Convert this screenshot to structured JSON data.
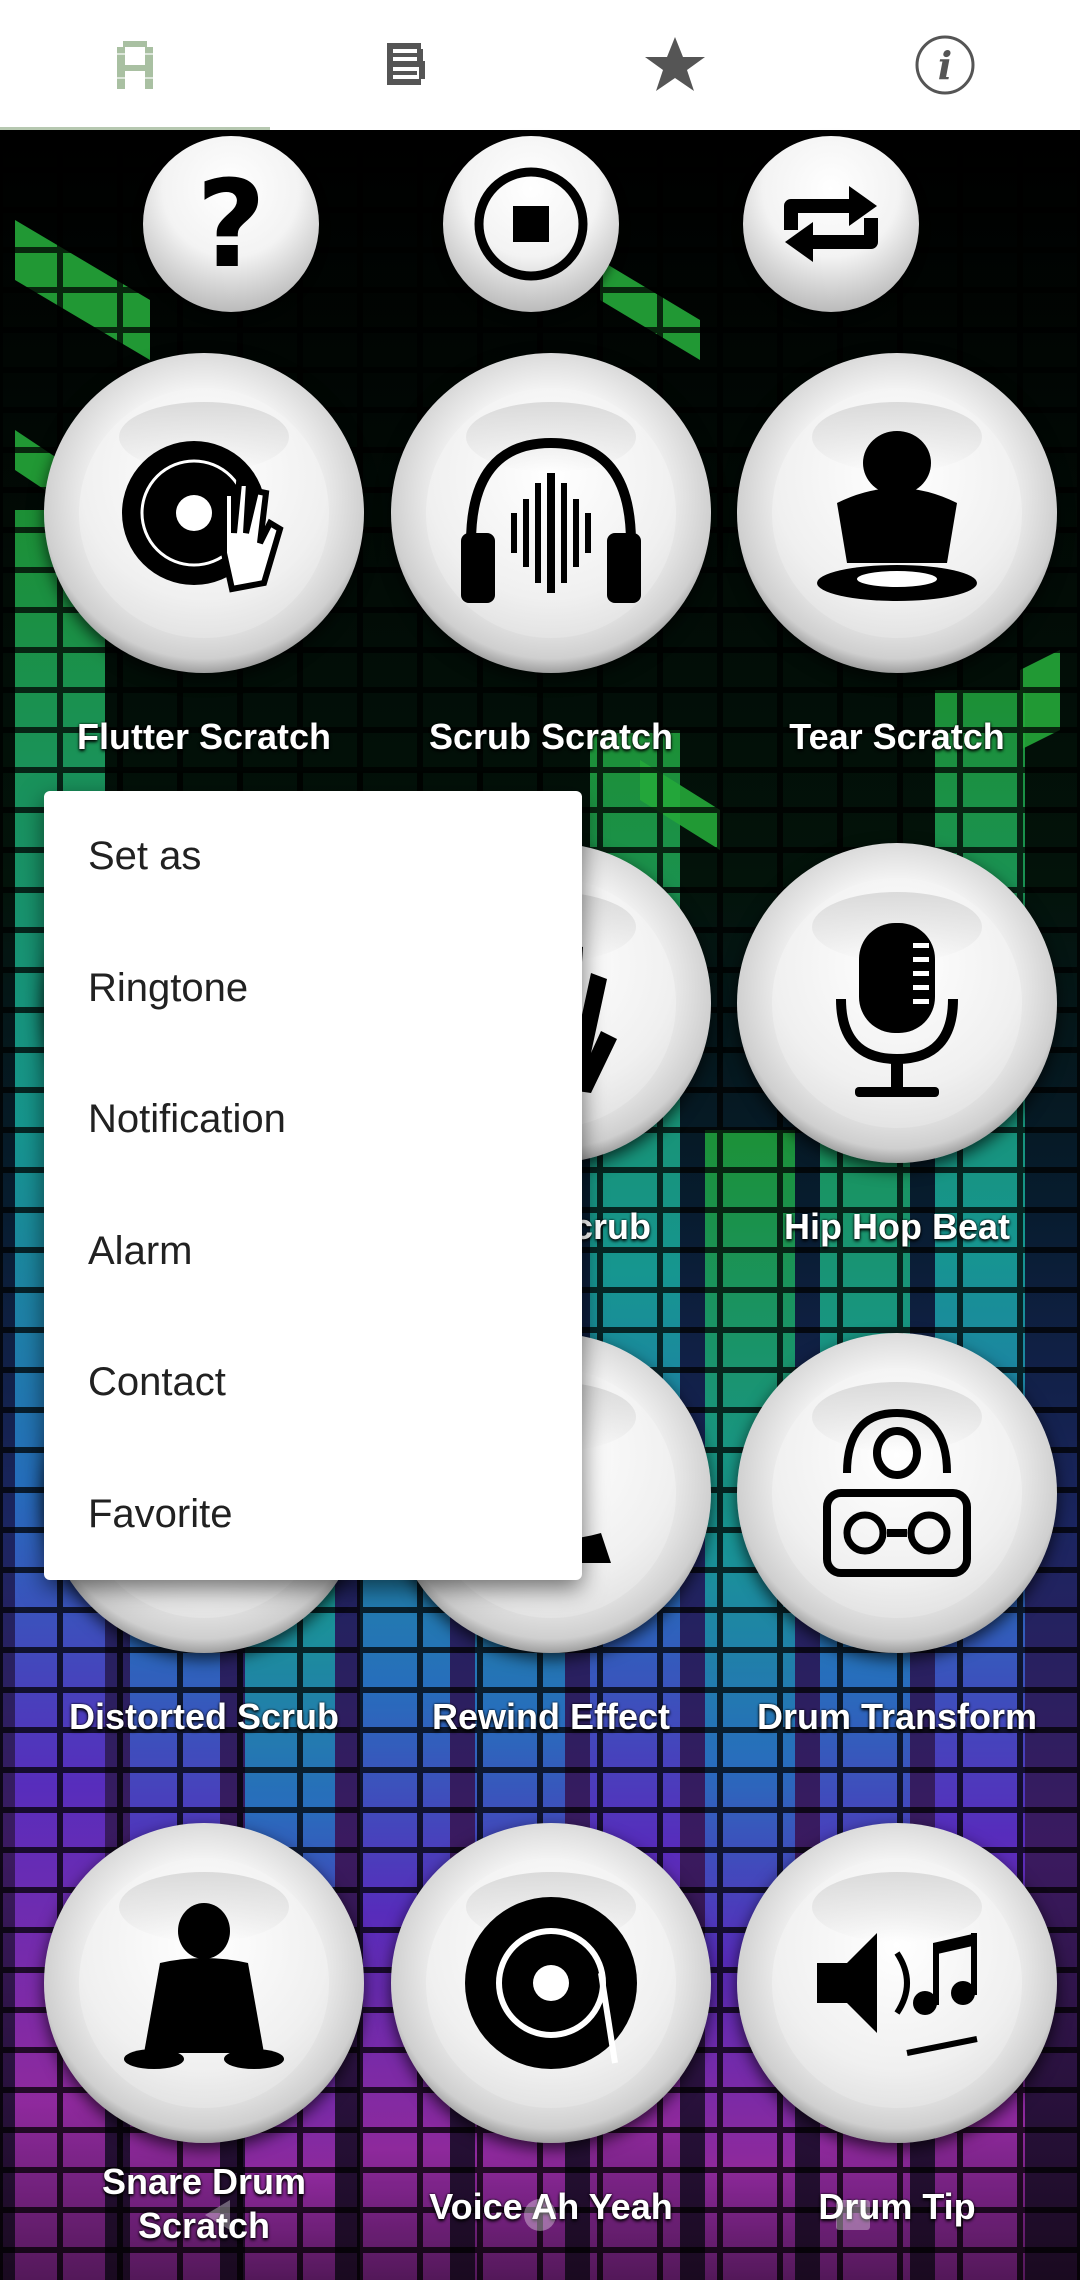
{
  "tabs": [
    {
      "name": "sounds",
      "icon": "a-letter-icon",
      "active": true
    },
    {
      "name": "list",
      "icon": "list-icon",
      "active": false
    },
    {
      "name": "favorites",
      "icon": "star-icon",
      "active": false
    },
    {
      "name": "info",
      "icon": "info-icon",
      "active": false
    }
  ],
  "controls": [
    {
      "icon": "help-icon"
    },
    {
      "icon": "stop-icon"
    },
    {
      "icon": "repeat-icon"
    }
  ],
  "sounds": [
    {
      "label": "Flutter Scratch",
      "icon": "dj-turntable-hand-icon"
    },
    {
      "label": "Scrub Scratch",
      "icon": "headphones-wave-icon"
    },
    {
      "label": "Tear Scratch",
      "icon": "dj-person-icon"
    },
    {
      "label": "Baby Scrub",
      "icon": "hand-icon"
    },
    {
      "label": "Hip Hop Beat",
      "icon": "microphone-icon"
    },
    {
      "label": "Distorted Scrub",
      "icon": "dj-icon"
    },
    {
      "label": "Rewind Effect",
      "icon": "turntable-icon"
    },
    {
      "label": "Drum Transform",
      "icon": "boombox-icon"
    },
    {
      "label": "Snare Drum Scratch",
      "icon": "dj-mixer-person-icon"
    },
    {
      "label": "Voice Ah Yeah",
      "icon": "vinyl-icon"
    },
    {
      "label": "Drum Tip",
      "icon": "speaker-notes-icon"
    }
  ],
  "menu": {
    "items": [
      "Set as",
      "Ringtone",
      "Notification",
      "Alarm",
      "Contact",
      "Favorite"
    ]
  },
  "colors": {
    "accent": "#b6c8b0",
    "label": "#ffffff",
    "menu_bg": "#ffffff",
    "menu_text": "#212121"
  }
}
